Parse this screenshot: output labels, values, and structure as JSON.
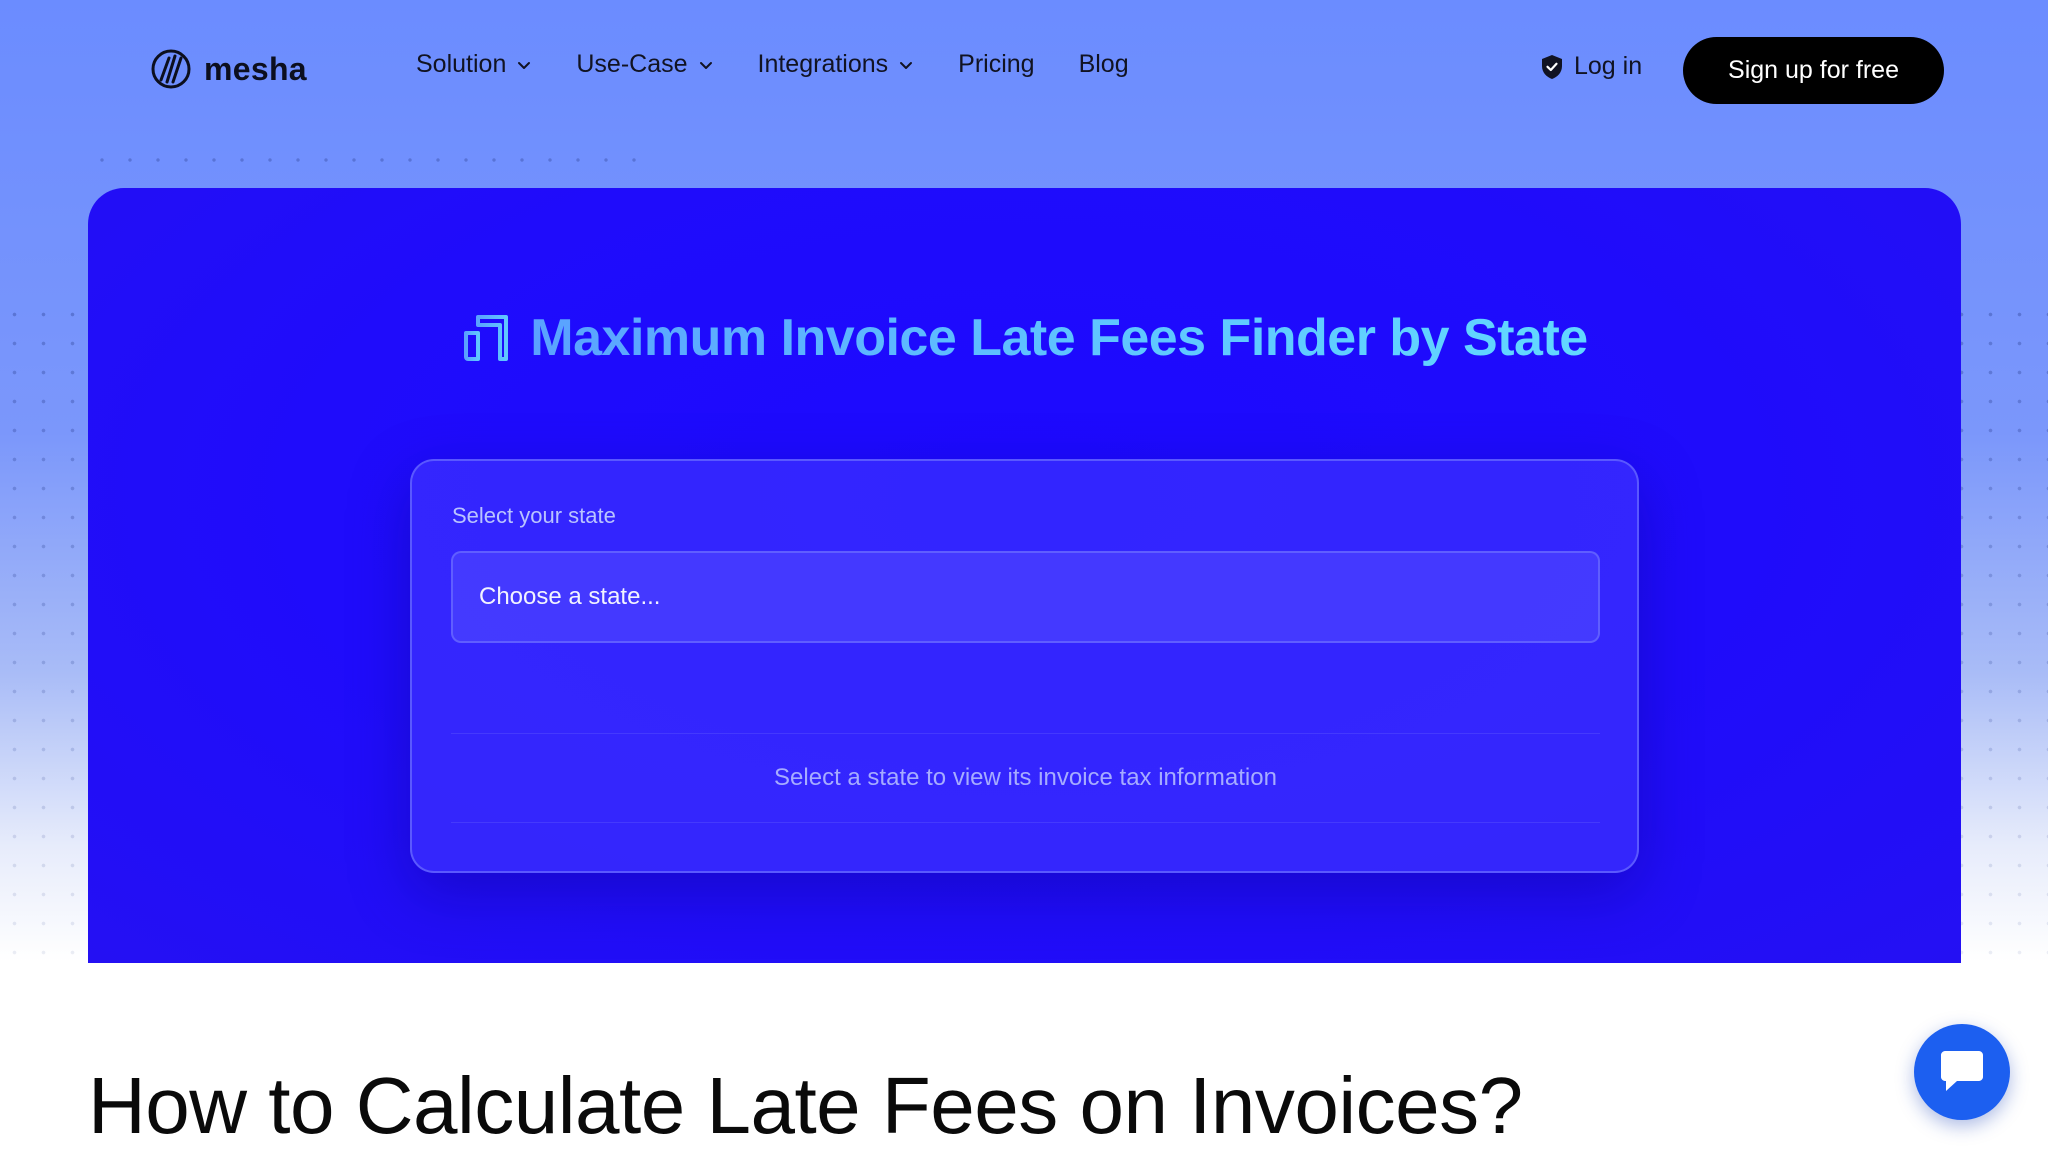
{
  "brand": {
    "name": "mesha"
  },
  "nav": {
    "items": [
      {
        "label": "Solution",
        "has_dropdown": true
      },
      {
        "label": "Use-Case",
        "has_dropdown": true
      },
      {
        "label": "Integrations",
        "has_dropdown": true
      },
      {
        "label": "Pricing",
        "has_dropdown": false
      },
      {
        "label": "Blog",
        "has_dropdown": false
      }
    ],
    "login_label": "Log in",
    "signup_label": "Sign up for free"
  },
  "hero": {
    "title": "Maximum Invoice Late Fees Finder by State",
    "icon": "receipt-icon"
  },
  "finder": {
    "label": "Select your state",
    "select_value": "Choose a state...",
    "empty_message": "Select a state to view its invoice tax information"
  },
  "section": {
    "heading": "How to Calculate Late Fees on Invoices?"
  },
  "icons": {
    "logo": "mesha-logo-icon",
    "chevron": "chevron-down-icon",
    "login": "shield-icon",
    "chat": "chat-icon"
  },
  "colors": {
    "accent": "#1f0cfb",
    "signup_bg": "#000000",
    "chat_bg": "#1c5ff0",
    "title_gradient_start": "#5aa2ff",
    "title_gradient_end": "#62d8ff"
  }
}
